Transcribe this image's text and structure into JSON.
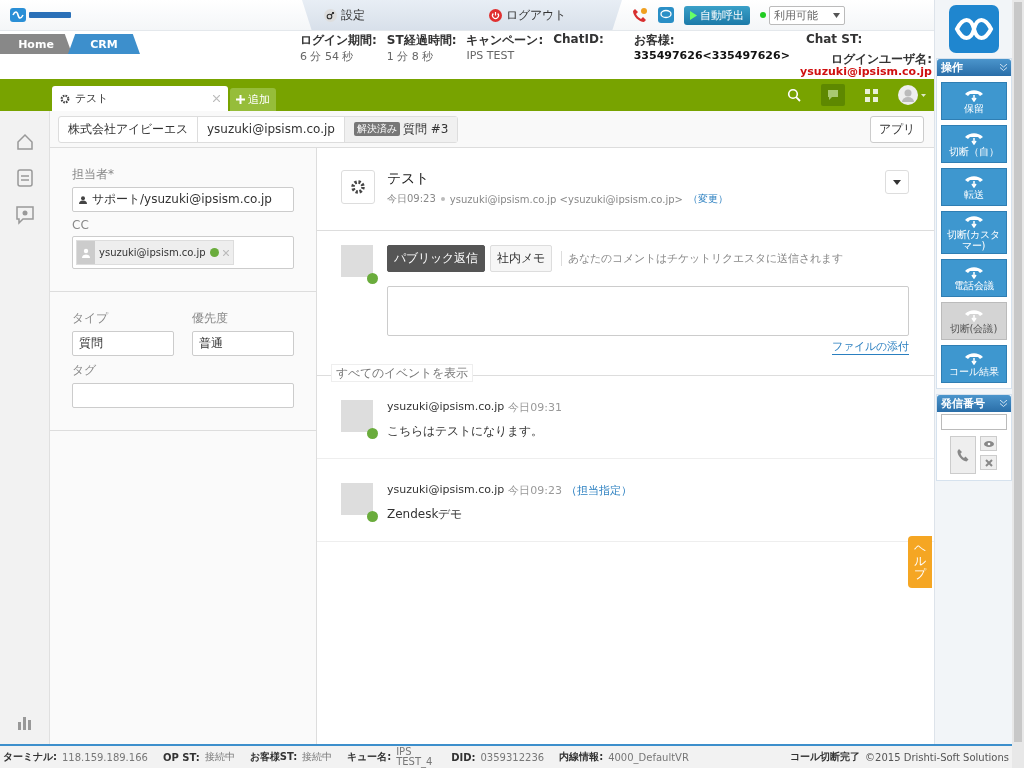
{
  "topbar": {
    "settings": "設定",
    "logout": "ログアウト",
    "auto_call": "自動呼出",
    "status": {
      "value": "利用可能",
      "color": "#22cc22"
    }
  },
  "nav_tabs": [
    {
      "label": "Home",
      "selected": false
    },
    {
      "label": "CRM",
      "selected": true
    }
  ],
  "info": [
    {
      "label": "ログイン期間:",
      "value": "6 分 54 秒"
    },
    {
      "label": "ST経過時間:",
      "value": "1 分 8 秒"
    },
    {
      "label": "キャンペーン:",
      "value": "IPS TEST"
    },
    {
      "label": "ChatID:"
    },
    {
      "label": "お客様:",
      "value": "335497626<335497626>"
    },
    {
      "label": "Chat ST:"
    }
  ],
  "login_user": {
    "label": "ログインユーザ名:",
    "value": "ysuzuki@ipsism.co.jp"
  },
  "tabs": [
    {
      "label": "テスト",
      "selected": true
    }
  ],
  "add_tab": "追加",
  "breadcrumbs": [
    {
      "label": "株式会社アイビーエス"
    },
    {
      "label": "ysuzuki@ipsism.co.jp"
    },
    {
      "badge": "解決済み",
      "label": "質問 #3"
    }
  ],
  "apps_button": "アプリ",
  "form": {
    "assignee": {
      "label": "担当者*",
      "value": "サポート/ysuzuki@ipsism.co.jp"
    },
    "cc": {
      "label": "CC",
      "chips": [
        "ysuzuki@ipsism.co.jp"
      ]
    },
    "type": {
      "label": "タイプ",
      "value": "質問"
    },
    "priority": {
      "label": "優先度",
      "value": "普通"
    },
    "tags": {
      "label": "タグ"
    }
  },
  "ticket": {
    "title": "テスト",
    "time": "今日09:23",
    "requester": "ysuzuki@ipsism.co.jp <ysuzuki@ipsism.co.jp>",
    "change": "（変更）"
  },
  "reply": {
    "modes": [
      {
        "label": "パブリック返信",
        "selected": true
      },
      {
        "label": "社内メモ",
        "selected": false
      }
    ],
    "hint": "あなたのコメントはチケットリクエスタに送信されます",
    "attach": "ファイルの添付"
  },
  "events_label": "すべてのイベントを表示",
  "events": [
    {
      "author": "ysuzuki@ipsism.co.jp",
      "time": "今日09:31",
      "body": "こちらはテストになります。"
    },
    {
      "author": "ysuzuki@ipsism.co.jp",
      "time": "今日09:23",
      "action": "（担当指定）",
      "body": "Zendeskデモ"
    }
  ],
  "help_tab": "ヘルプ",
  "ops": {
    "title": "操作",
    "buttons": [
      {
        "label": "保留",
        "disabled": false
      },
      {
        "label": "切断（自）",
        "disabled": false
      },
      {
        "label": "転送",
        "disabled": false
      },
      {
        "label": "切断(カスタマー)",
        "disabled": false
      },
      {
        "label": "電話会議",
        "disabled": false
      },
      {
        "label": "切断(会議)",
        "disabled": true
      },
      {
        "label": "コール結果",
        "disabled": false
      }
    ]
  },
  "dial": {
    "title": "発信番号"
  },
  "footer": {
    "items": [
      {
        "label": "ターミナル:",
        "value": "118.159.189.166"
      },
      {
        "label": "OP ST:",
        "value": "接続中"
      },
      {
        "label": "お客様ST:",
        "value": "接続中"
      },
      {
        "label": "キュー名:",
        "value": "IPS TEST_4"
      },
      {
        "label": "DID:",
        "value": "0359312236"
      },
      {
        "label": "内線情報:",
        "value": "4000_DefaultVR"
      }
    ],
    "status": "コール切断完了",
    "copyright": "©2015 Drishti-Soft Solutions"
  }
}
